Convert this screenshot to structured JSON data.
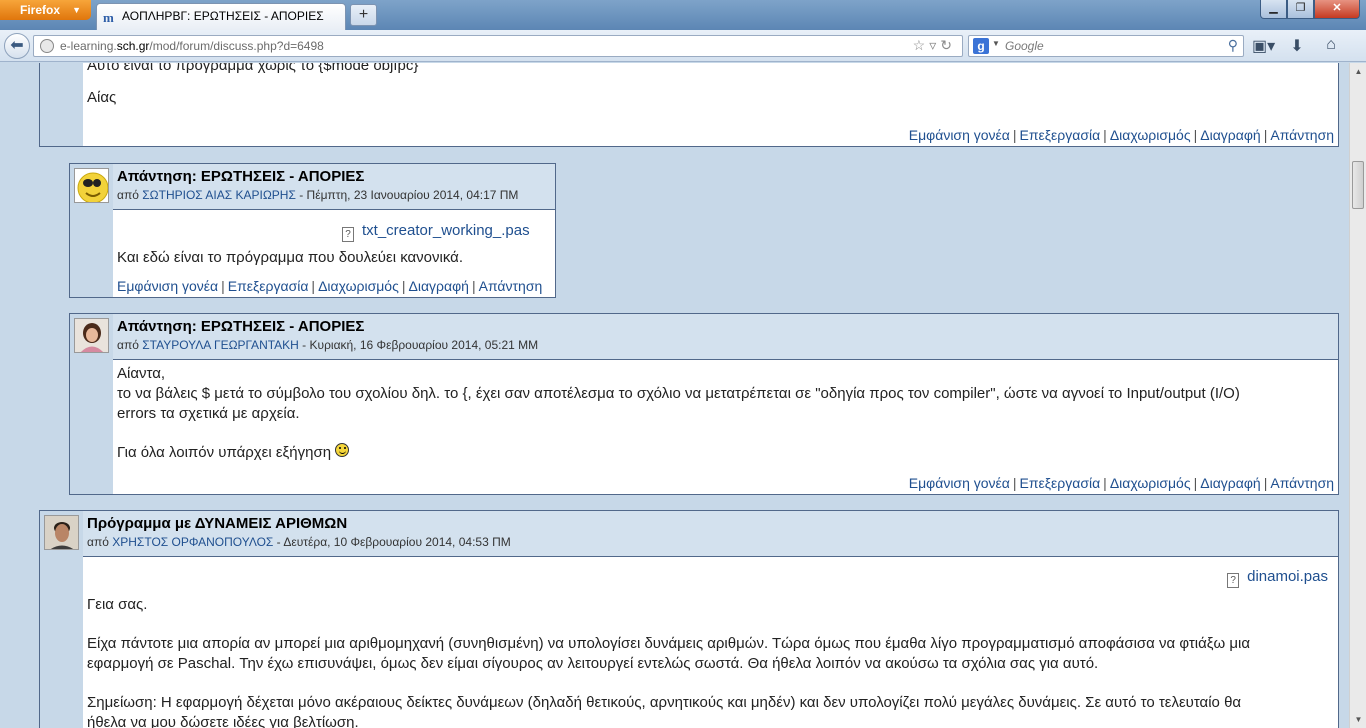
{
  "browser": {
    "menu_label": "Firefox",
    "tab_title": "ΑΟΠΛΗΡΒΓ: ΕΡΩΤΗΣΕΙΣ - ΑΠΟΡΙΕΣ",
    "new_tab_label": "+",
    "url_domain_prefix": "e-learning.",
    "url_domain": "sch.gr",
    "url_path": "/mod/forum/discuss.php?d=6498",
    "search_placeholder": "Google"
  },
  "post_top": {
    "line1": "Αυτό είναι το πρόγραμμα χωρίς το {$mode objfpc}",
    "line2": "Αίας",
    "commands": [
      "Εμφάνιση γονέα",
      "Επεξεργασία",
      "Διαχωρισμός",
      "Διαγραφή",
      "Απάντηση"
    ]
  },
  "post_reply1": {
    "subject": "Απάντηση: ΕΡΩΤΗΣΕΙΣ - ΑΠΟΡΙΕΣ",
    "by": "από",
    "author": "ΣΩΤΗΡΙΟΣ ΑΙΑΣ ΚΑΡΙΩΡΗΣ",
    "date": " - Πέμπτη, 23 Ιανουαρίου 2014, 04:17 ΠΜ",
    "attachment": "txt_creator_working_.pas",
    "text": "Και εδώ είναι το πρόγραμμα που δουλεύει κανονικά.",
    "commands": [
      "Εμφάνιση γονέα",
      "Επεξεργασία",
      "Διαχωρισμός",
      "Διαγραφή",
      "Απάντηση"
    ]
  },
  "post_reply2": {
    "subject": "Απάντηση: ΕΡΩΤΗΣΕΙΣ - ΑΠΟΡΙΕΣ",
    "by": "από",
    "author": "ΣΤΑΥΡΟΥΛΑ ΓΕΩΡΓΑΝΤΑΚΗ",
    "date": " - Κυριακή, 16 Φεβρουαρίου 2014, 05:21 ΜΜ",
    "line1": "Αίαντα,",
    "line2": "το να βάλεις $ μετά το σύμβολο του σχολίου δηλ. το {, έχει σαν αποτέλεσμα το σχόλιο να μετατρέπεται σε \"οδηγία προς τον compiler\", ώστε να αγνοεί το Input/output (I/O)",
    "line3": "errors τα σχετικά με αρχεία.",
    "line4": "Για όλα λοιπόν υπάρχει εξήγηση",
    "commands": [
      "Εμφάνιση γονέα",
      "Επεξεργασία",
      "Διαχωρισμός",
      "Διαγραφή",
      "Απάντηση"
    ]
  },
  "post_new": {
    "subject": "Πρόγραμμα με ΔΥΝΑΜΕΙΣ ΑΡΙΘΜΩΝ",
    "by": "από",
    "author": "ΧΡΗΣΤΟΣ ΟΡΦΑΝΟΠΟΥΛΟΣ",
    "date": " - Δευτέρα, 10 Φεβρουαρίου 2014, 04:53 ΠΜ",
    "attachment": "dinamoi.pas",
    "greeting": "Γεια σας.",
    "p1_line1": "Είχα πάντοτε μια απορία αν μπορεί μια αριθμομηχανή (συνηθισμένη) να υπολογίσει δυνάμεις αριθμών. Τώρα όμως που έμαθα λίγο προγραμματισμό αποφάσισα να φτιάξω μια",
    "p1_line2": "εφαρμογή σε Paschal. Την έχω επισυνάψει, όμως δεν είμαι σίγουρος αν λειτουργεί εντελώς σωστά. Θα ήθελα λοιπόν να ακούσω τα σχόλια σας για αυτό.",
    "p2_line1": "Σημείωση: Η εφαρμογή δέχεται μόνο ακέραιους δείκτες δυνάμεων (δηλαδή θετικούς, αρνητικούς και μηδέν) και δεν υπολογίζει πολύ μεγάλες δυνάμεις. Σε αυτό το τελευταίο θα",
    "p2_line2": "ήθελα να μου δώσετε ιδέες για βελτίωση."
  }
}
